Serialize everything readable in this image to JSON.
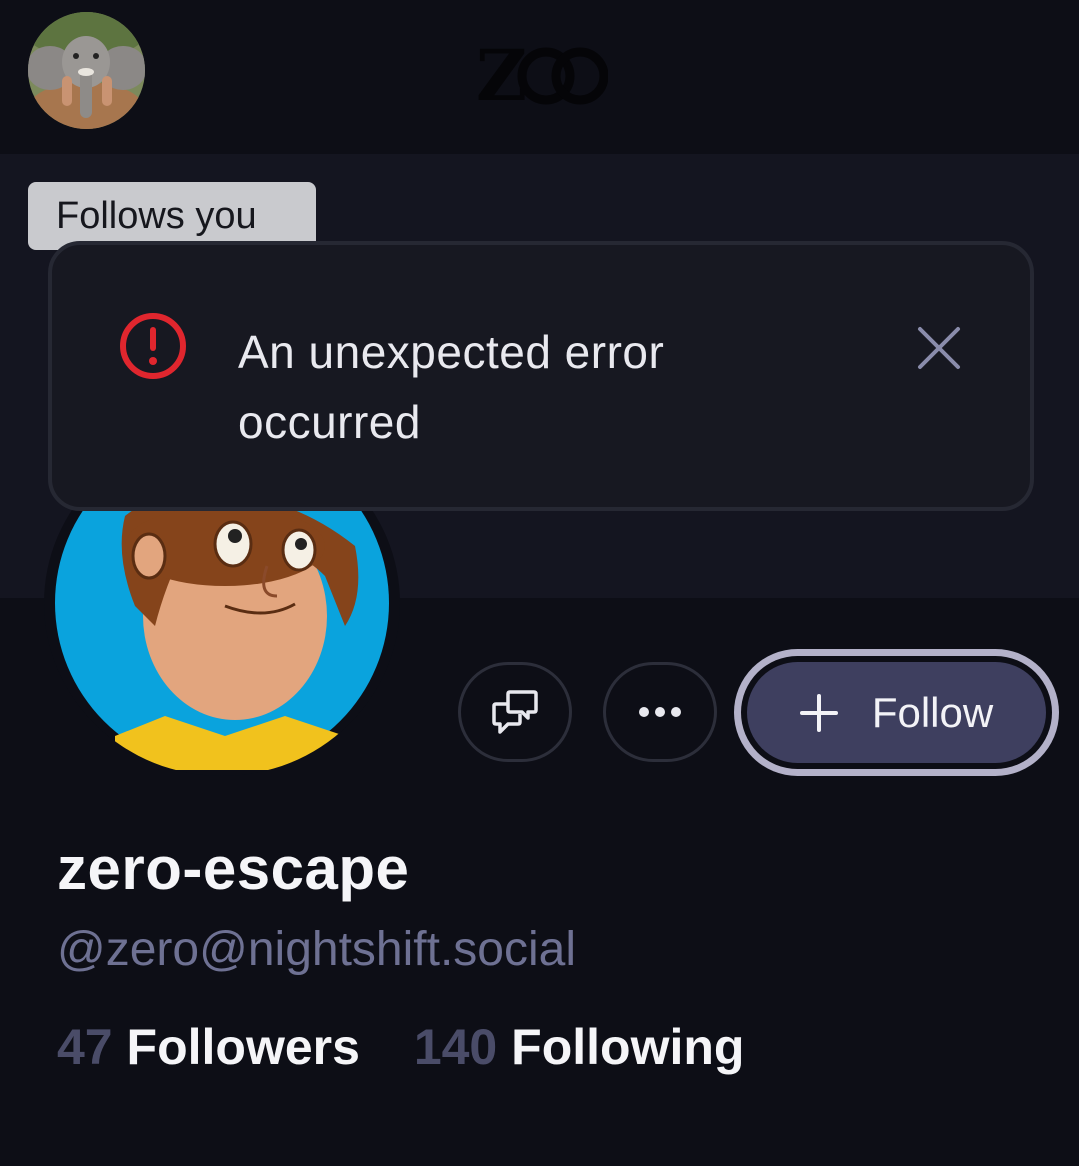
{
  "header": {
    "logo_text": "Zoo",
    "my_avatar_icon": "elephant-avatar"
  },
  "profile": {
    "follows_you_badge": "Follows you",
    "display_name": "zero-escape",
    "handle": "@zero@nightshift.social",
    "avatar_icon": "cartoon-boy-avatar",
    "followers_count": "47",
    "followers_label": "Followers",
    "following_count": "140",
    "following_label": "Following"
  },
  "actions": {
    "message_icon": "message-bubbles-icon",
    "more_icon": "ellipsis-icon",
    "follow_label": "Follow",
    "follow_icon": "plus-icon"
  },
  "toast": {
    "message": "An unexpected error occurred",
    "icon": "error-circle-icon",
    "close_icon": "close-icon"
  },
  "colors": {
    "background": "#0d0e16",
    "banner": "#141520",
    "accent": "#3e3f5f",
    "error": "#e0262e",
    "muted": "#6e7193"
  }
}
